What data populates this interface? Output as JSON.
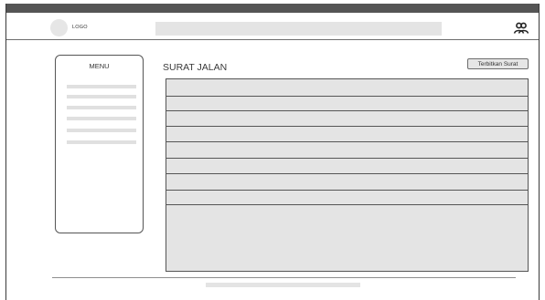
{
  "header": {
    "logo_text": "LOGO",
    "search_value": "",
    "user_icon": "user-group-icon"
  },
  "sidebar": {
    "title": "MENU",
    "items": [
      "",
      "",
      "",
      "",
      "",
      ""
    ]
  },
  "main": {
    "title": "SURAT JALAN",
    "issue_button_label": "Terbitkan Surat",
    "table_rows": [
      "",
      "",
      "",
      "",
      "",
      "",
      "",
      ""
    ]
  },
  "footer": {
    "content": ""
  },
  "colors": {
    "frame_border": "#3a3a3a",
    "top_bar": "#555555",
    "placeholder_fill": "#e4e4e4",
    "line": "#555555"
  }
}
